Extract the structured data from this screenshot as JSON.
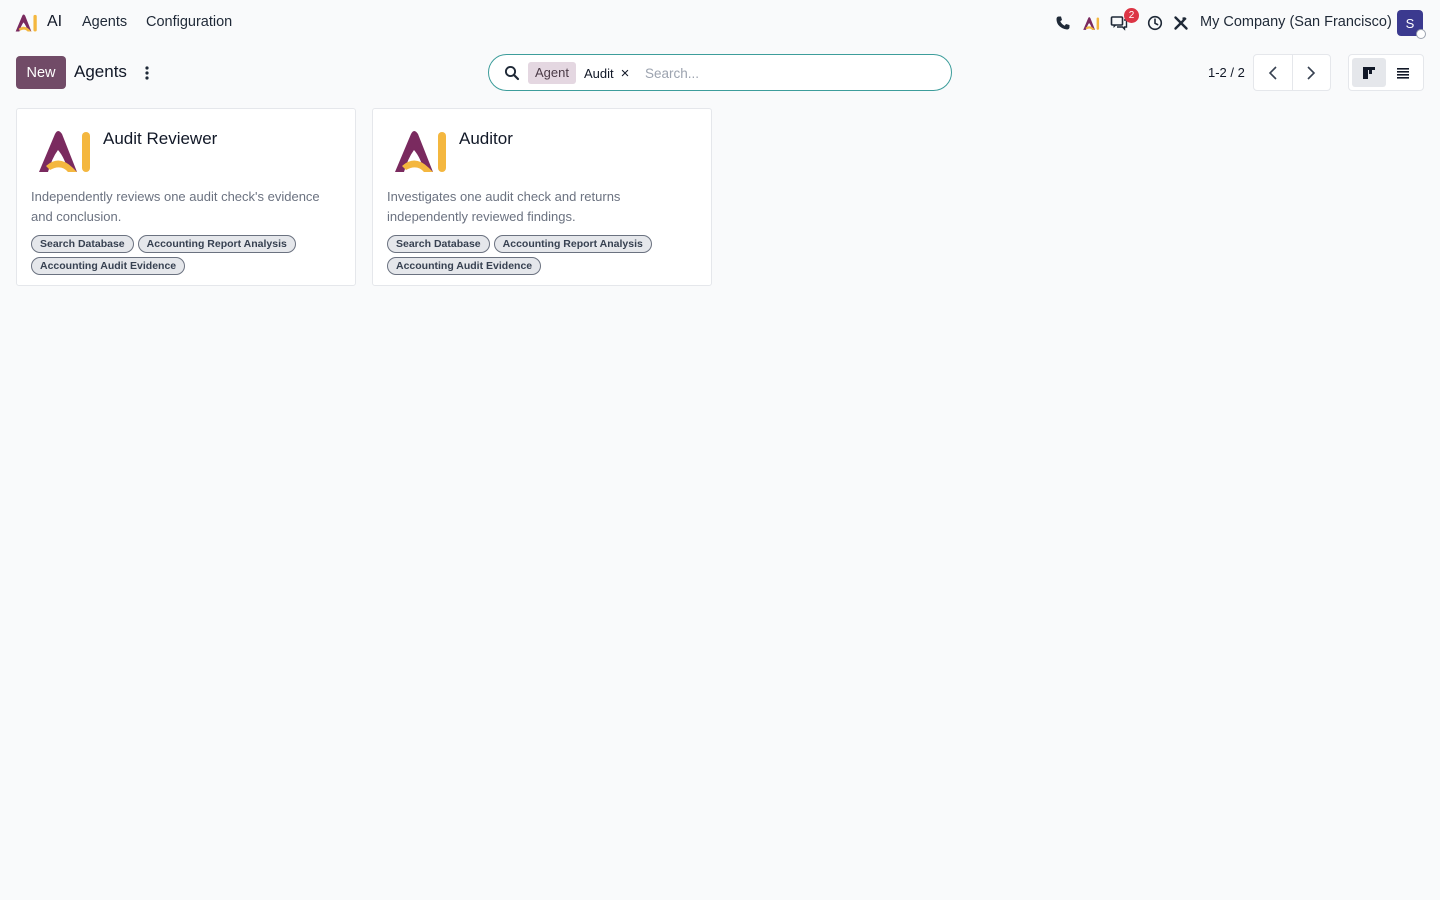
{
  "navbar": {
    "app_name": "AI",
    "menu": [
      {
        "label": "Agents"
      },
      {
        "label": "Configuration"
      }
    ],
    "messages_badge": "2",
    "company": "My Company (San Francisco)",
    "user_initial": "S"
  },
  "control_panel": {
    "new_label": "New",
    "title": "Agents",
    "search": {
      "facet_label": "Agent",
      "facet_value": "Audit",
      "facet_remove": "×",
      "placeholder": "Search..."
    },
    "pager": {
      "value": "1-2 / 2"
    }
  },
  "cards": [
    {
      "title": "Audit Reviewer",
      "description": "Independently reviews one audit check's evidence and conclusion.",
      "tags": [
        "Search Database",
        "Accounting Report Analysis",
        "Accounting Audit Evidence"
      ]
    },
    {
      "title": "Auditor",
      "description": "Investigates one audit check and returns independently reviewed findings.",
      "tags": [
        "Search Database",
        "Accounting Report Analysis",
        "Accounting Audit Evidence"
      ]
    }
  ],
  "colors": {
    "brand_primary": "#714b67",
    "accent_teal": "#3d9d9b",
    "logo_purple": "#7a2a5f",
    "logo_yellow": "#f4b73f",
    "badge_red": "#dc3545"
  },
  "icons": {
    "phone": "phone-icon",
    "ai": "ai-logo-icon",
    "messages": "messages-icon",
    "activity": "clock-icon",
    "debug": "tools-icon"
  }
}
